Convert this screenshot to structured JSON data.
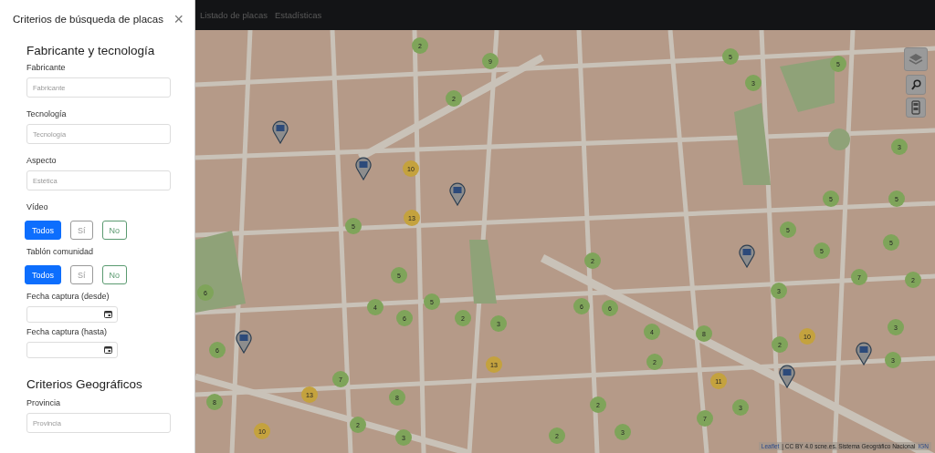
{
  "panel": {
    "title": "Criterios de búsqueda de placas",
    "close": "×",
    "sections": [
      {
        "heading": "Fabricante y tecnología",
        "fields": [
          {
            "kind": "text",
            "label": "Fabricante",
            "placeholder": "Fabricante"
          },
          {
            "kind": "text",
            "label": "Tecnología",
            "placeholder": "Tecnología"
          },
          {
            "kind": "text",
            "label": "Aspecto",
            "placeholder": "Estética"
          },
          {
            "kind": "toggle",
            "label": "Vídeo",
            "options": [
              {
                "label": "Todos",
                "kind": "primary",
                "selected": true
              },
              {
                "label": "Sí",
                "kind": "secondary",
                "selected": false
              },
              {
                "label": "No",
                "kind": "success",
                "selected": false
              }
            ]
          },
          {
            "kind": "toggle",
            "label": "Tablón comunidad",
            "options": [
              {
                "label": "Todos",
                "kind": "primary",
                "selected": true
              },
              {
                "label": "Sí",
                "kind": "secondary",
                "selected": false
              },
              {
                "label": "No",
                "kind": "success",
                "selected": false
              }
            ]
          },
          {
            "kind": "date",
            "label": "Fecha captura (desde)"
          },
          {
            "kind": "date",
            "label": "Fecha captura (hasta)"
          }
        ]
      },
      {
        "heading": "Criterios Geográficos",
        "fields": [
          {
            "kind": "text",
            "label": "Provincia",
            "placeholder": "Provincia"
          }
        ]
      }
    ]
  },
  "navbar": {
    "links": [
      "Listado de placas",
      "Estadísticas"
    ]
  },
  "map": {
    "clusters": [
      {
        "count": "2",
        "color": "#7fa45a"
      },
      {
        "count": "9",
        "color": "#7fa45a"
      },
      {
        "count": "5",
        "color": "#7fa45a"
      },
      {
        "count": "5",
        "color": "#7fa45a"
      },
      {
        "count": "3",
        "color": "#7fa45a"
      },
      {
        "count": "2",
        "color": "#7fa45a"
      },
      {
        "count": "3",
        "color": "#7fa45a"
      },
      {
        "count": "10",
        "color": "#c4a23e"
      },
      {
        "count": "5",
        "color": "#7fa45a"
      },
      {
        "count": "5",
        "color": "#7fa45a"
      },
      {
        "count": "13",
        "color": "#c4a23e"
      },
      {
        "count": "5",
        "color": "#7fa45a"
      },
      {
        "count": "5",
        "color": "#7fa45a"
      },
      {
        "count": "5",
        "color": "#7fa45a"
      },
      {
        "count": "5",
        "color": "#7fa45a"
      },
      {
        "count": "2",
        "color": "#7fa45a"
      },
      {
        "count": "5",
        "color": "#7fa45a"
      },
      {
        "count": "7",
        "color": "#7fa45a"
      },
      {
        "count": "2",
        "color": "#7fa45a"
      },
      {
        "count": "6",
        "color": "#7fa45a"
      },
      {
        "count": "3",
        "color": "#7fa45a"
      },
      {
        "count": "5",
        "color": "#7fa45a"
      },
      {
        "count": "4",
        "color": "#7fa45a"
      },
      {
        "count": "6",
        "color": "#7fa45a"
      },
      {
        "count": "6",
        "color": "#7fa45a"
      },
      {
        "count": "6",
        "color": "#7fa45a"
      },
      {
        "count": "2",
        "color": "#7fa45a"
      },
      {
        "count": "3",
        "color": "#7fa45a"
      },
      {
        "count": "4",
        "color": "#7fa45a"
      },
      {
        "count": "8",
        "color": "#7fa45a"
      },
      {
        "count": "2",
        "color": "#7fa45a"
      },
      {
        "count": "10",
        "color": "#c4a23e"
      },
      {
        "count": "3",
        "color": "#7fa45a"
      },
      {
        "count": "6",
        "color": "#7fa45a"
      },
      {
        "count": "2",
        "color": "#7fa45a"
      },
      {
        "count": "13",
        "color": "#c4a23e"
      },
      {
        "count": "3",
        "color": "#7fa45a"
      },
      {
        "count": "7",
        "color": "#7fa45a"
      },
      {
        "count": "11",
        "color": "#c4a23e"
      },
      {
        "count": "13",
        "color": "#c4a23e"
      },
      {
        "count": "8",
        "color": "#7fa45a"
      },
      {
        "count": "8",
        "color": "#7fa45a"
      },
      {
        "count": "2",
        "color": "#7fa45a"
      },
      {
        "count": "3",
        "color": "#7fa45a"
      },
      {
        "count": "2",
        "color": "#7fa45a"
      },
      {
        "count": "10",
        "color": "#c4a23e"
      },
      {
        "count": "7",
        "color": "#7fa45a"
      },
      {
        "count": "3",
        "color": "#7fa45a"
      },
      {
        "count": "3",
        "color": "#7fa45a"
      },
      {
        "count": "2",
        "color": "#7fa45a"
      }
    ],
    "attribution": {
      "link": "Leaflet",
      "text": "| CC BY 4.0 scne.es. Sistema Geográfico Nacional",
      "source": "IGN"
    }
  }
}
